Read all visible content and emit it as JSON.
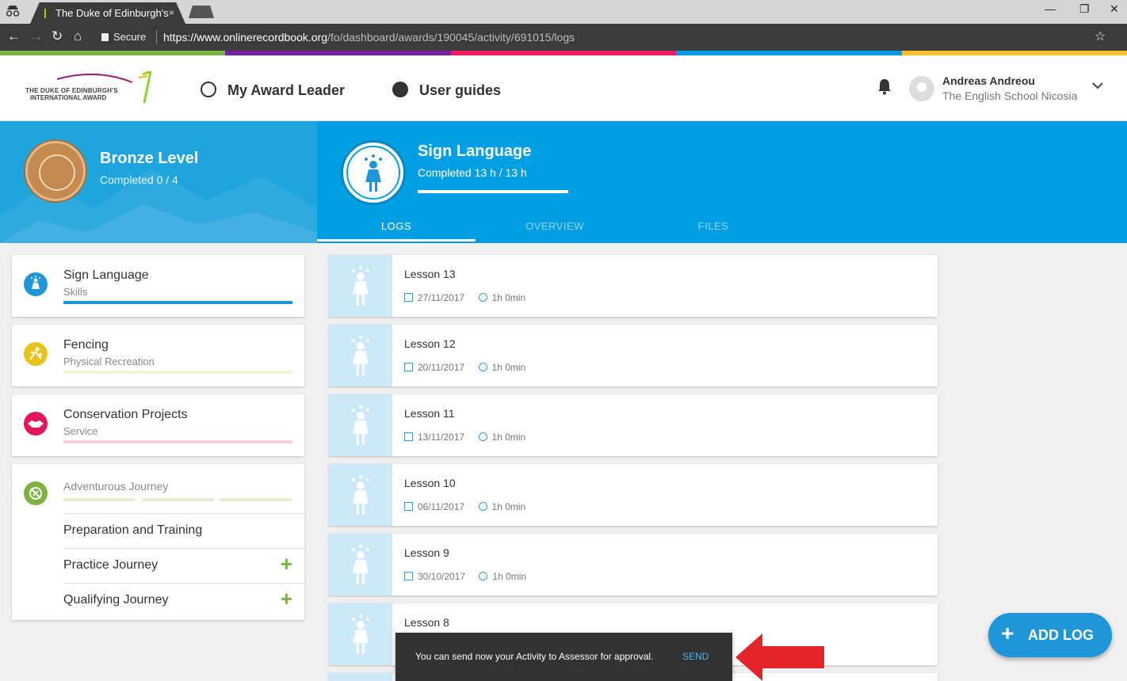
{
  "browser": {
    "tab_title": "The Duke of Edinburgh's",
    "tab_close": "×",
    "secure_label": "Secure",
    "url_host": "https://www.onlinerecordbook.org",
    "url_path": "/fo/dashboard/awards/190045/activity/691015/logs",
    "win_min": "—",
    "win_max": "❐",
    "win_close": "✕",
    "back": "←",
    "forward": "→",
    "reload": "↻",
    "home": "⌂",
    "star": "☆"
  },
  "brand_colors": [
    "#7cb342",
    "#7b1fa2",
    "#e91e63",
    "#039be5",
    "#fbc02d"
  ],
  "header": {
    "logo_line1": "THE DUKE OF EDINBURGH'S",
    "logo_line2": "INTERNATIONAL AWARD",
    "nav": [
      {
        "label": "My Award Leader",
        "icon": "smiley-face-icon"
      },
      {
        "label": "User guides",
        "icon": "info-icon"
      }
    ],
    "user_name": "Andreas Andreou",
    "user_school": "The English School Nicosia",
    "chevron": "⌄"
  },
  "level": {
    "title": "Bronze Level",
    "subtitle": "Completed 0 / 4"
  },
  "activity": {
    "title": "Sign Language",
    "subtitle": "Completed 13 h / 13 h",
    "progress": 1.0,
    "tabs": [
      "LOGS",
      "OVERVIEW",
      "FILES"
    ],
    "active_tab": "LOGS"
  },
  "sidebar": {
    "categories": [
      {
        "name": "Sign Language",
        "type": "Skills",
        "color": "#1e96d8",
        "progress": 1.0
      },
      {
        "name": "Fencing",
        "type": "Physical Recreation",
        "color": "#e8c21c",
        "progress": 0.0
      },
      {
        "name": "Conservation Projects",
        "type": "Service",
        "color": "#e91e63",
        "progress": 0.0
      }
    ],
    "adventurous": {
      "name": "Adventurous Journey",
      "color": "#7cb342",
      "items": [
        "Preparation and Training",
        "Practice Journey",
        "Qualifying Journey"
      ],
      "plus": "+"
    }
  },
  "logs": [
    {
      "title": "Lesson 13",
      "date": "27/11/2017",
      "duration": "1h 0min"
    },
    {
      "title": "Lesson 12",
      "date": "20/11/2017",
      "duration": "1h 0min"
    },
    {
      "title": "Lesson 11",
      "date": "13/11/2017",
      "duration": "1h 0min"
    },
    {
      "title": "Lesson 10",
      "date": "06/11/2017",
      "duration": "1h 0min"
    },
    {
      "title": "Lesson 9",
      "date": "30/10/2017",
      "duration": "1h 0min"
    },
    {
      "title": "Lesson 8",
      "date": "",
      "duration": ""
    }
  ],
  "snackbar": {
    "message": "You can send now your Activity to Assessor for approval.",
    "action": "SEND"
  },
  "fab": {
    "plus": "+",
    "label": "ADD LOG"
  }
}
